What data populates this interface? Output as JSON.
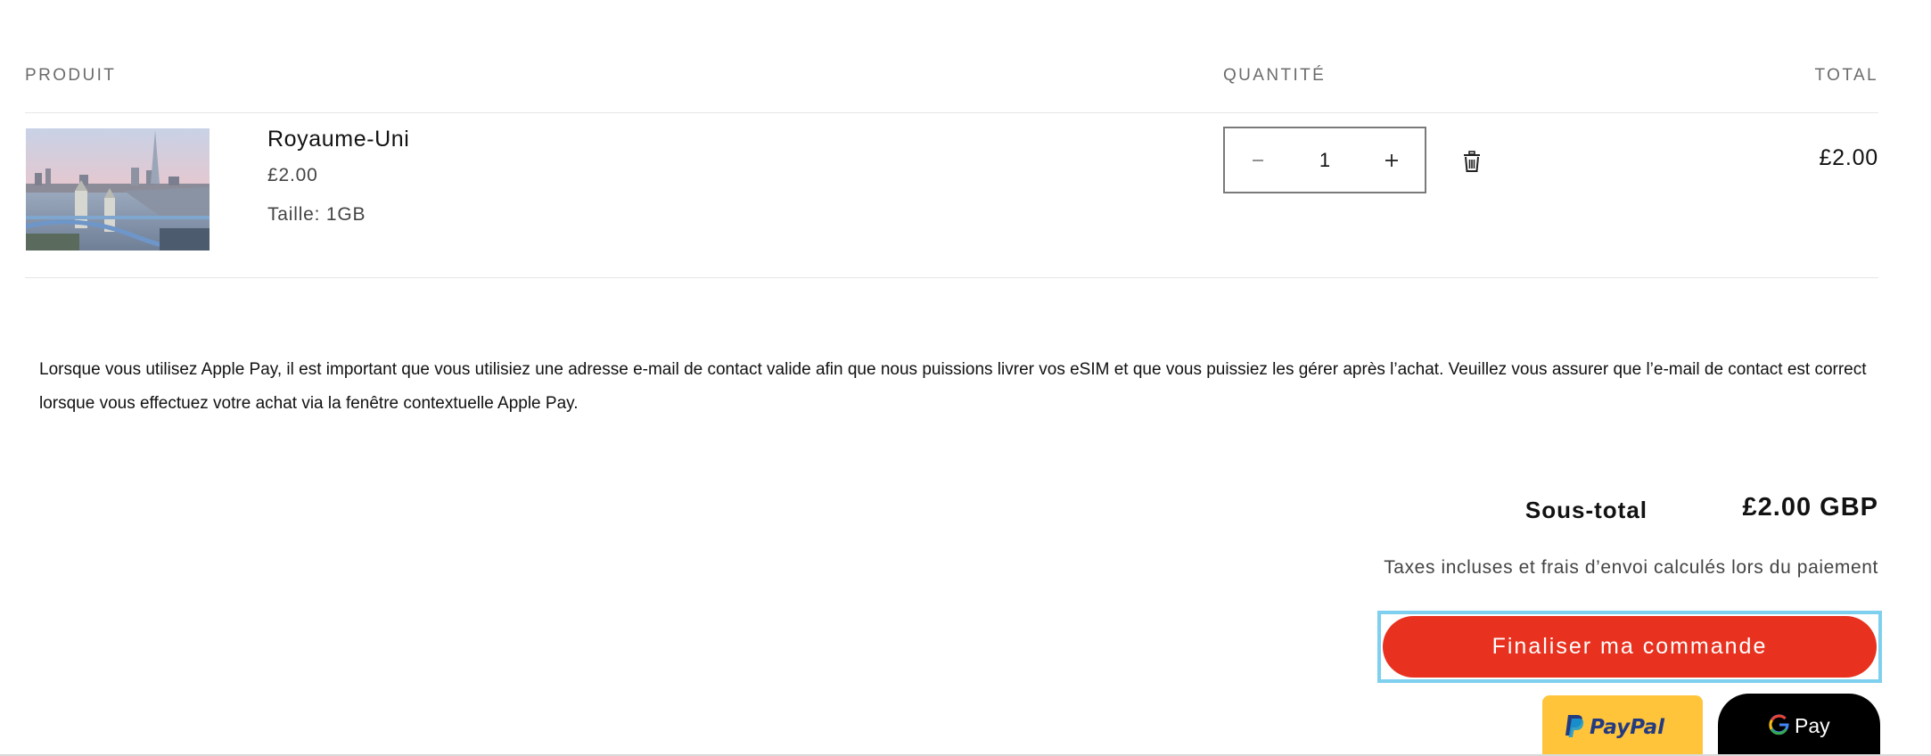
{
  "cart": {
    "columns": {
      "product": "PRODUIT",
      "quantity": "QUANTITÉ",
      "total": "TOTAL"
    },
    "item": {
      "image_icon": "london-tower-bridge-photo",
      "name": "Royaume-Uni",
      "price": "£2.00",
      "variant": "Taille: 1GB",
      "quantity": "1",
      "line_total": "£2.00",
      "decrease_icon": "minus-icon",
      "increase_icon": "plus-icon",
      "remove_icon": "trash-icon"
    }
  },
  "notice": {
    "text": "Lorsque vous utilisez Apple Pay, il est important que vous utilisiez une adresse e-mail de contact valide afin que nous puissions livrer vos eSIM et que vous puissiez les gérer après l’achat. Veuillez vous assurer que l’e-mail de contact est correct lorsque vous effectuez votre achat via la fenêtre contextuelle Apple Pay."
  },
  "summary": {
    "subtotal_label": "Sous-total",
    "subtotal_value": "£2.00 GBP",
    "tax_note": "Taxes incluses et frais d’envoi calculés lors du paiement",
    "checkout_label": "Finaliser ma commande",
    "paypal_label": "PayPal",
    "gpay_label": "G Pay"
  },
  "colors": {
    "checkout_button": "#e8321f",
    "checkout_focus_ring": "#7fd0ee",
    "paypal_button": "#ffc439",
    "gpay_button": "#000000"
  }
}
